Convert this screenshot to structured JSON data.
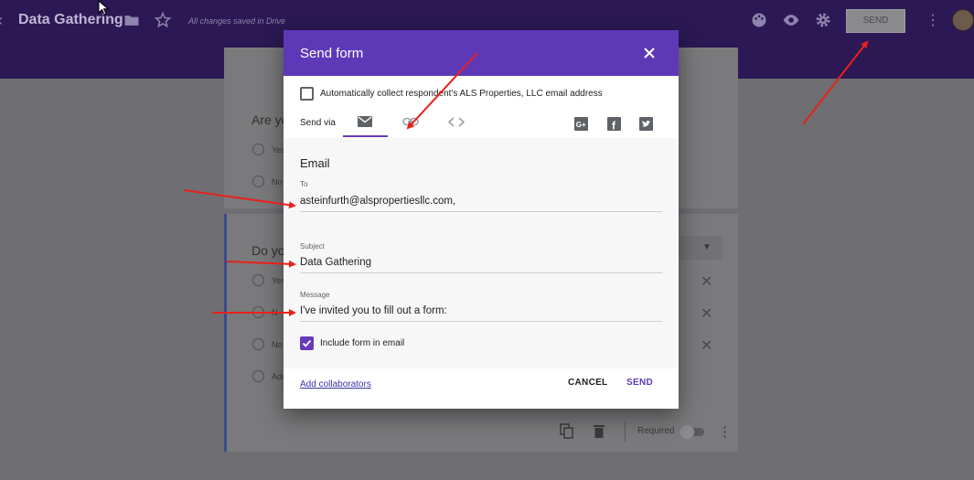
{
  "topbar": {
    "title": "Data Gathering",
    "saved_status": "All changes saved in Drive",
    "send_label": "SEND",
    "icons": [
      "folder-icon",
      "star-icon",
      "palette-icon",
      "eye-icon",
      "gear-icon",
      "more-vert-icon"
    ]
  },
  "background_form": {
    "question1": "Are yo",
    "q1_options": [
      "Yes",
      "No"
    ],
    "question2": "Do yo",
    "q2_options": [
      "Yes",
      "N",
      "No",
      "Add"
    ]
  },
  "dialog": {
    "title": "Send form",
    "collect_email_label": "Automatically collect respondent's ALS Properties, LLC email address",
    "collect_email_checked": false,
    "send_via_label": "Send via",
    "send_via_tabs": [
      "email-icon",
      "link-icon",
      "embed-icon"
    ],
    "active_tab": "email",
    "share_icons": [
      "google-plus-icon",
      "facebook-icon",
      "twitter-icon"
    ],
    "section_title": "Email",
    "to_label": "To",
    "to_value": "asteinfurth@alspropertiesllc.com,",
    "subject_label": "Subject",
    "subject_value": "Data Gathering",
    "message_label": "Message",
    "message_value": "I've invited you to fill out a form:",
    "include_form_label": "Include form in email",
    "include_form_checked": true,
    "add_collaborators": "Add collaborators",
    "cancel_label": "CANCEL",
    "send_label": "SEND"
  },
  "bottom_toolbar": {
    "required_label": "Required",
    "required_on": false
  },
  "colors": {
    "brand_purple": "#673ab7",
    "header_purple": "#5d39b8",
    "arrow_red": "#e8211a"
  }
}
